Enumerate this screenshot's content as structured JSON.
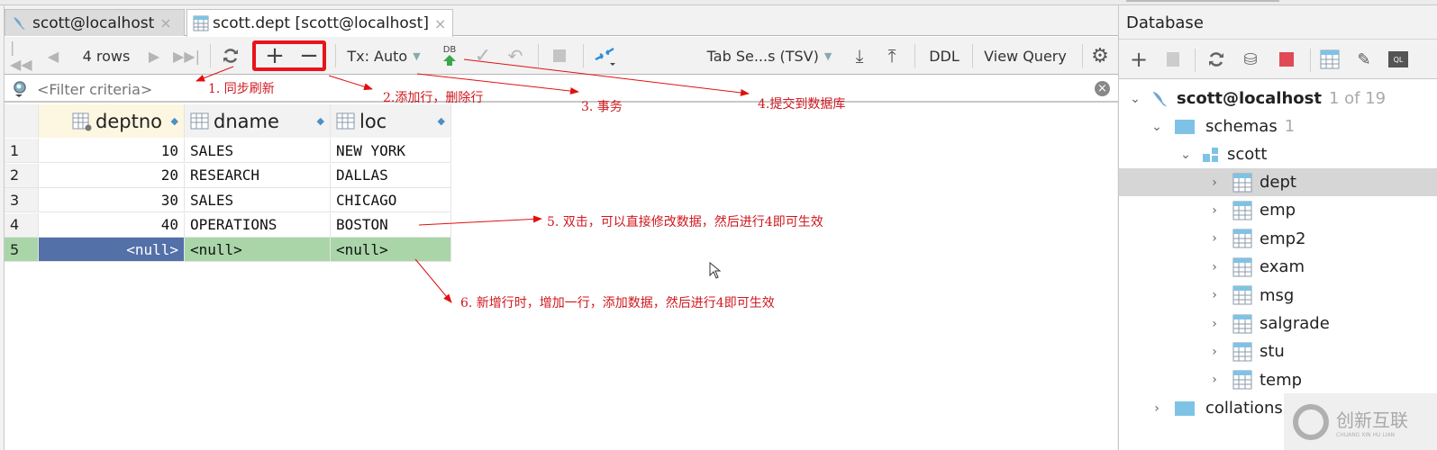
{
  "tabs": [
    {
      "label": "scott@localhost",
      "icon": "mysql-dolphin-icon",
      "active": false
    },
    {
      "label": "scott.dept [scott@localhost]",
      "icon": "table-icon",
      "active": true
    }
  ],
  "toolbar": {
    "row_count": "4 rows",
    "tx_mode": "Tx: Auto",
    "db_label": "DB",
    "format": "Tab Se...s (TSV)",
    "ddl": "DDL",
    "view_query": "View Query"
  },
  "filter": {
    "placeholder": "<Filter criteria>"
  },
  "grid": {
    "columns": [
      "deptno",
      "dname",
      "loc"
    ],
    "rows": [
      {
        "num": "1",
        "deptno": "10",
        "dname": "SALES",
        "loc": "NEW YORK"
      },
      {
        "num": "2",
        "deptno": "20",
        "dname": "RESEARCH",
        "loc": "DALLAS"
      },
      {
        "num": "3",
        "deptno": "30",
        "dname": "SALES",
        "loc": "CHICAGO"
      },
      {
        "num": "4",
        "deptno": "40",
        "dname": "OPERATIONS",
        "loc": "BOSTON"
      },
      {
        "num": "5",
        "deptno": "<null>",
        "dname": "<null>",
        "loc": "<null>",
        "new": true
      }
    ]
  },
  "annotations": {
    "a1": "1. 同步刷新",
    "a2": "2.添加行，删除行",
    "a3": "3. 事务",
    "a4": "4.提交到数据库",
    "a5": "5. 双击，可以直接修改数据，然后进行4即可生效",
    "a6": "6. 新增行时，增加一行，添加数据，然后进行4即可生效"
  },
  "database": {
    "title": "Database",
    "connection": "scott@localhost",
    "connection_count": "1 of 19",
    "schemas_label": "schemas",
    "schemas_count": "1",
    "schema": "scott",
    "tables": [
      "dept",
      "emp",
      "emp2",
      "exam",
      "msg",
      "salgrade",
      "stu",
      "temp"
    ],
    "selected_table": "dept",
    "collations": "collations"
  },
  "watermark": {
    "text": "创新互联",
    "sub": "CHUANG XIN HU LIAN"
  },
  "colors": {
    "accent_red": "#e8141b",
    "annotation_red": "#d0171e",
    "selected_cell": "#5470a8",
    "new_row": "#a9d5a9",
    "header_active": "#fdf6e0"
  }
}
